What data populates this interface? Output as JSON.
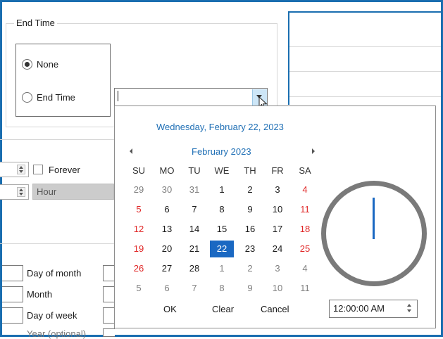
{
  "end_time_group": {
    "title": "End Time",
    "options": [
      {
        "label": "None",
        "checked": true
      },
      {
        "label": "End Time",
        "checked": false
      }
    ],
    "date_value": ""
  },
  "recurrence": {
    "forever_label": "Forever",
    "forever_checked": false,
    "unit_value": "Hour"
  },
  "fields": {
    "day_of_month": "Day of month",
    "month": "Month",
    "day_of_week": "Day of week",
    "year_partial": "Year (optional)"
  },
  "calendar": {
    "long_date": "Wednesday, February 22, 2023",
    "month_title": "February 2023",
    "day_names": [
      "SU",
      "MO",
      "TU",
      "WE",
      "TH",
      "FR",
      "SA"
    ],
    "weeks": [
      [
        {
          "d": "29",
          "t": "other"
        },
        {
          "d": "30",
          "t": "other"
        },
        {
          "d": "31",
          "t": "other"
        },
        {
          "d": "1",
          "t": "cur"
        },
        {
          "d": "2",
          "t": "cur"
        },
        {
          "d": "3",
          "t": "cur"
        },
        {
          "d": "4",
          "t": "weekend"
        }
      ],
      [
        {
          "d": "5",
          "t": "weekend"
        },
        {
          "d": "6",
          "t": "cur"
        },
        {
          "d": "7",
          "t": "cur"
        },
        {
          "d": "8",
          "t": "cur"
        },
        {
          "d": "9",
          "t": "cur"
        },
        {
          "d": "10",
          "t": "cur"
        },
        {
          "d": "11",
          "t": "weekend"
        }
      ],
      [
        {
          "d": "12",
          "t": "weekend"
        },
        {
          "d": "13",
          "t": "cur"
        },
        {
          "d": "14",
          "t": "cur"
        },
        {
          "d": "15",
          "t": "cur"
        },
        {
          "d": "16",
          "t": "cur"
        },
        {
          "d": "17",
          "t": "cur"
        },
        {
          "d": "18",
          "t": "weekend"
        }
      ],
      [
        {
          "d": "19",
          "t": "weekend"
        },
        {
          "d": "20",
          "t": "cur"
        },
        {
          "d": "21",
          "t": "cur"
        },
        {
          "d": "22",
          "t": "selected"
        },
        {
          "d": "23",
          "t": "cur"
        },
        {
          "d": "24",
          "t": "cur"
        },
        {
          "d": "25",
          "t": "weekend"
        }
      ],
      [
        {
          "d": "26",
          "t": "weekend"
        },
        {
          "d": "27",
          "t": "cur"
        },
        {
          "d": "28",
          "t": "cur"
        },
        {
          "d": "1",
          "t": "other"
        },
        {
          "d": "2",
          "t": "other"
        },
        {
          "d": "3",
          "t": "other"
        },
        {
          "d": "4",
          "t": "other"
        }
      ],
      [
        {
          "d": "5",
          "t": "other"
        },
        {
          "d": "6",
          "t": "other"
        },
        {
          "d": "7",
          "t": "other"
        },
        {
          "d": "8",
          "t": "other"
        },
        {
          "d": "9",
          "t": "other"
        },
        {
          "d": "10",
          "t": "other"
        },
        {
          "d": "11",
          "t": "other"
        }
      ]
    ],
    "ok_label": "OK",
    "clear_label": "Clear",
    "cancel_label": "Cancel",
    "time_value": "12:00:00 AM"
  },
  "colors": {
    "accent": "#1a6eb0",
    "selected_bg": "#1a68c2",
    "weekend": "#e02727",
    "link_text": "#1f6fb5"
  },
  "icons": {
    "prev": "triangle-left",
    "next": "triangle-right",
    "dropdown": "triangle-down",
    "cursor": "mouse-pointer-arrow"
  }
}
